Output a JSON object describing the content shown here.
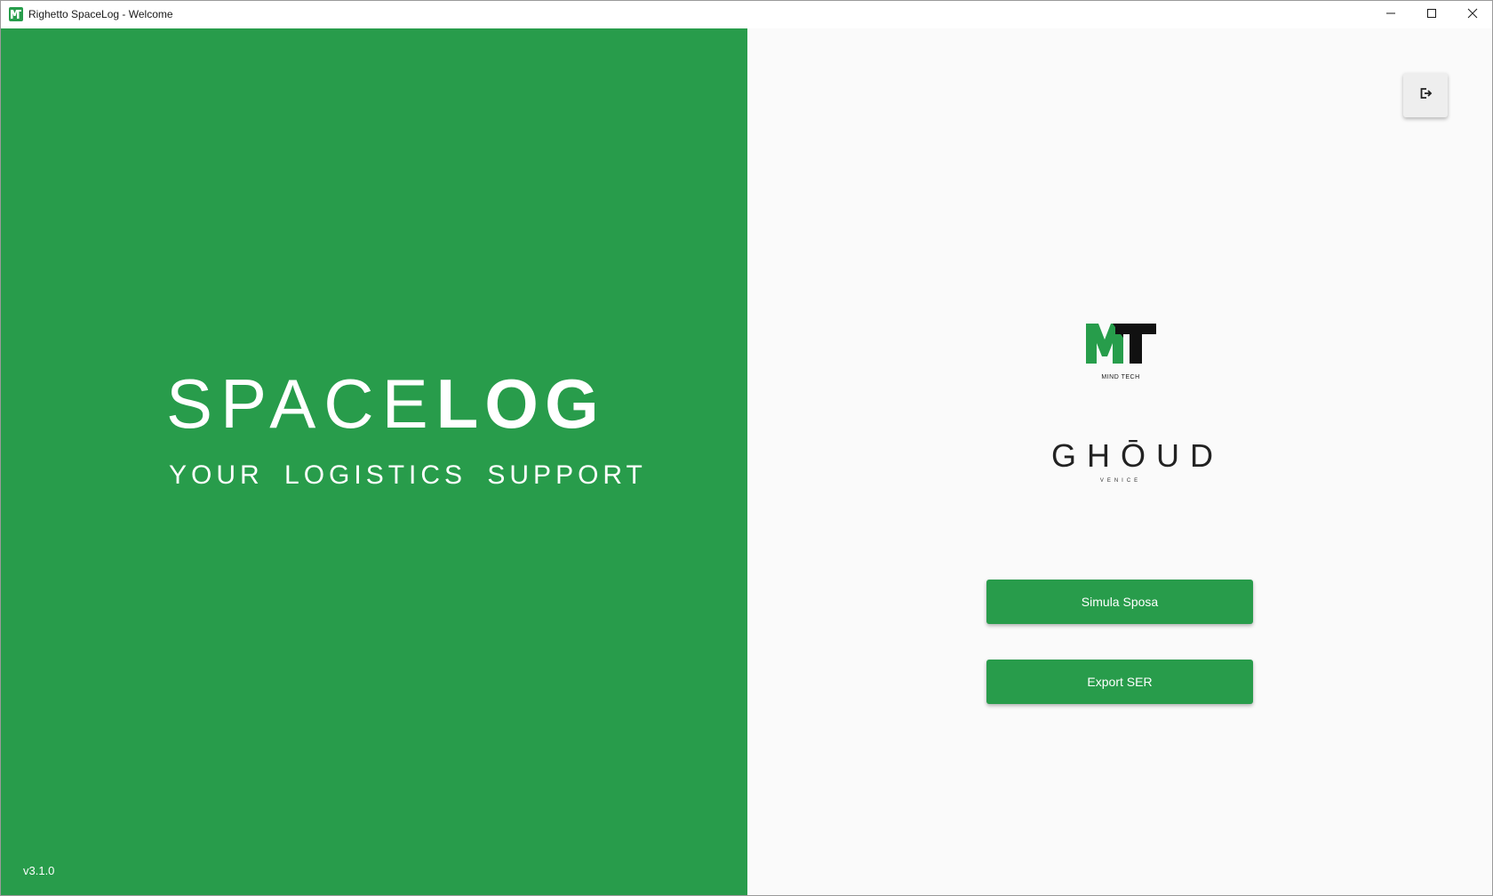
{
  "window": {
    "title": "Righetto SpaceLog - Welcome",
    "app_icon": "mt-app-icon",
    "controls": [
      "minimize-icon",
      "maximize-icon",
      "close-icon"
    ]
  },
  "brand": {
    "name_light": "SPACE",
    "name_bold": "LOG",
    "tagline": "YOUR LOGISTICS SUPPORT"
  },
  "version": "v3.1.0",
  "logos": {
    "mindtech": {
      "mark": "MT",
      "caption": "MIND TECH"
    },
    "ghoud": {
      "word": "GHŌUD",
      "sub": "VENICE"
    }
  },
  "actions": {
    "logout_icon": "logout-icon",
    "simula_label": "Simula Sposa",
    "export_label": "Export SER"
  },
  "colors": {
    "primary_green": "#289c4b",
    "panel_bg": "#fafafa"
  }
}
